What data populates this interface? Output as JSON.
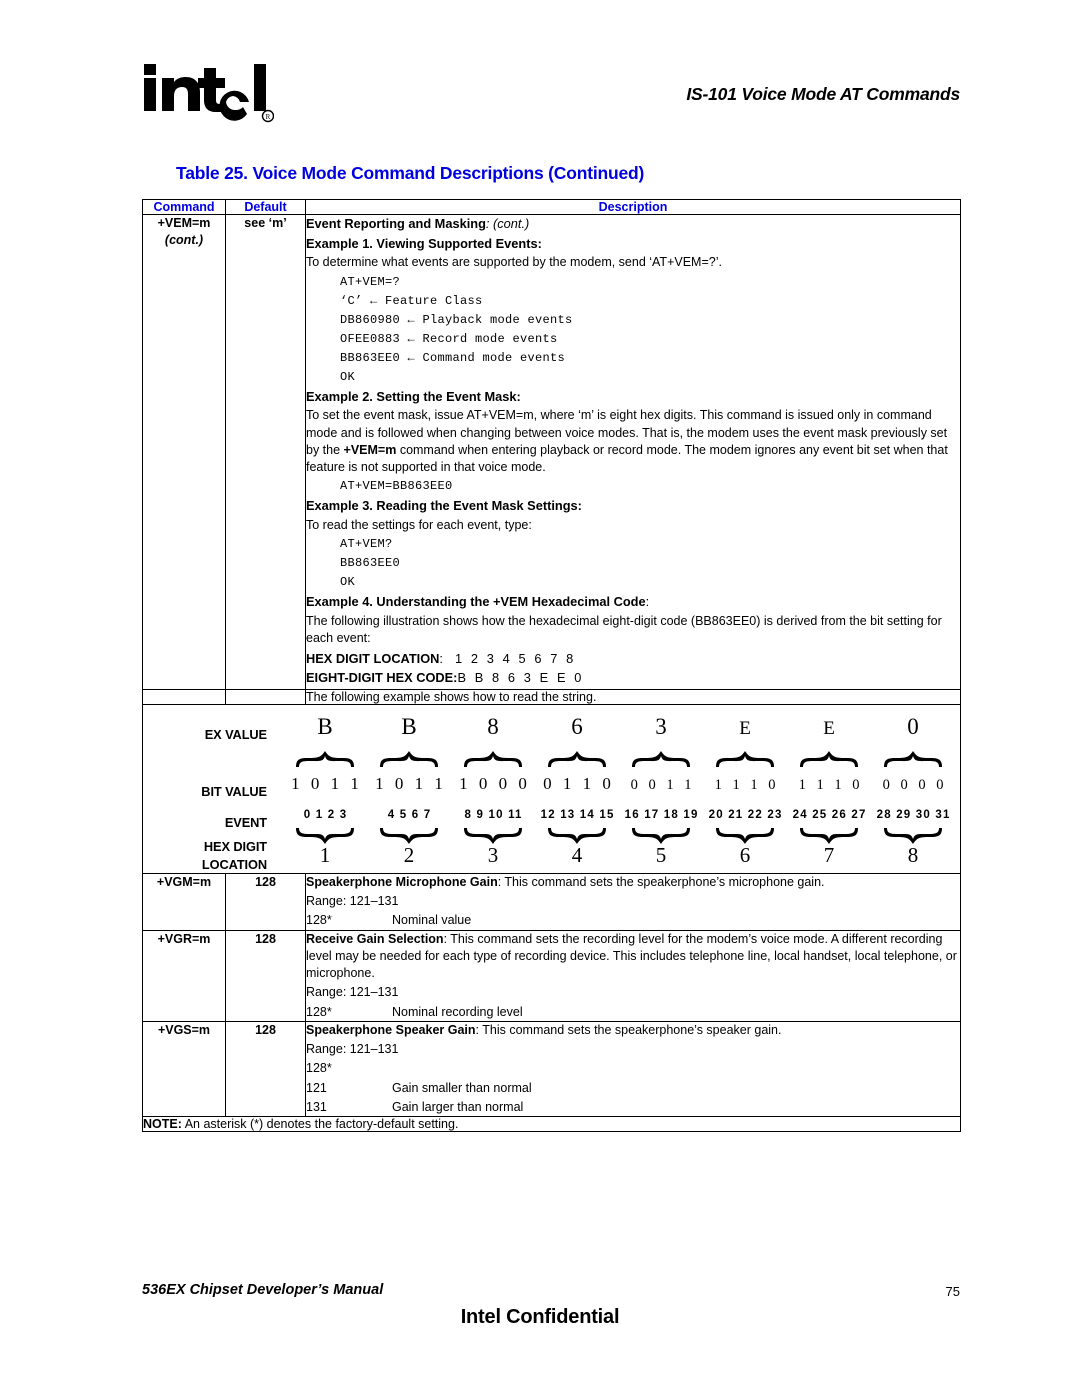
{
  "header": {
    "logo_alt": "intel",
    "title": "IS-101 Voice Mode AT Commands"
  },
  "table_caption": "Table 25.  Voice Mode Command Descriptions (Continued)",
  "table": {
    "columns": [
      "Command",
      "Default",
      "Description"
    ],
    "vem_row": {
      "command": "+VEM=m",
      "command_cont": "(cont.)",
      "default": "see ‘m’",
      "section_title": "Event Reporting and Masking",
      "section_title_suffix": ": (cont.)",
      "example1_heading": "Example 1. Viewing Supported Events:",
      "example1_intro": "To determine what events are supported by the modem, send ‘AT+VEM=?’.",
      "example1_code": [
        "AT+VEM=?",
        "‘C’ ← Feature Class",
        "DB860980 ← Playback mode events",
        "OFEE0883 ← Record mode events",
        "BB863EE0 ← Command mode events",
        "OK"
      ],
      "example2_heading": "Example 2. Setting the Event Mask:",
      "example2_body_1": "To set the event mask, issue AT+VEM=m, where ‘m’ is eight hex digits. This command is issued only in command mode and is followed when changing between voice modes. That is, the modem uses the event mask previously set by the ",
      "example2_body_bold": "+VEM=m",
      "example2_body_2": " command when entering playback or record mode. The modem ignores any event bit set when that feature is not supported in that voice mode.",
      "example2_code": [
        "AT+VEM=BB863EE0"
      ],
      "example3_heading": "Example 3. Reading the Event Mask Settings:",
      "example3_intro": "To read the settings for each event, type:",
      "example3_code": [
        "AT+VEM?",
        "BB863EE0",
        "OK"
      ],
      "example4_heading": "Example 4. Understanding the +VEM Hexadecimal Code",
      "example4_heading_suffix": ":",
      "example4_body": "The following illustration shows how the hexadecimal eight-digit code (BB863EE0) is derived from the bit setting for each event:",
      "hex_digit_location_label": "HEX DIGIT LOCATION",
      "hex_digit_location_colon": ":",
      "hex_digit_location_digits": "1 2 3 4 5 6 7 8",
      "eight_digit_hex_label": "EIGHT-DIGIT HEX CODE:",
      "eight_digit_hex_digits": "B B 8 6 3 E E 0"
    },
    "diagram_intro": "The following example shows how to read the string.",
    "diagram": {
      "labels": {
        "ex_value": "EX VALUE",
        "bit_value": "BIT VALUE",
        "event": "EVENT",
        "hex_digit_line1": "HEX DIGIT",
        "hex_digit_line2": "LOCATION"
      },
      "columns": [
        {
          "ex_value": "B",
          "bit_value": "1 0 1 1",
          "events": "0 1 2 3",
          "hex_location": "1"
        },
        {
          "ex_value": "B",
          "bit_value": "1 0 1 1",
          "events": "4 5 6 7",
          "hex_location": "2"
        },
        {
          "ex_value": "8",
          "bit_value": "1 0 0 0",
          "events": "8 9 10 11",
          "hex_location": "3"
        },
        {
          "ex_value": "6",
          "bit_value": "0 1 1 0",
          "events": "12 13 14 15",
          "hex_location": "4"
        },
        {
          "ex_value": "3",
          "bit_value": "0 0 1 1",
          "events": "16 17 18 19",
          "hex_location": "5"
        },
        {
          "ex_value": "E",
          "bit_value": "1 1 1 0",
          "events": "20 21 22 23",
          "hex_location": "6"
        },
        {
          "ex_value": "E",
          "bit_value": "1 1 1 0",
          "events": "24 25 26 27",
          "hex_location": "7"
        },
        {
          "ex_value": "0",
          "bit_value": "0 0 0 0",
          "events": "28 29 30 31",
          "hex_location": "8"
        }
      ]
    },
    "vgm_row": {
      "command": "+VGM=m",
      "default": "128",
      "title": "Speakerphone Microphone Gain",
      "description": ": This command sets the speakerphone’s microphone gain.",
      "range": "Range: 121–131",
      "values": [
        {
          "value": "128*",
          "meaning": "Nominal value"
        }
      ]
    },
    "vgr_row": {
      "command": "+VGR=m",
      "default": "128",
      "title": "Receive Gain Selection",
      "description": ": This command sets the recording level for the modem’s voice mode. A different recording level may be needed for each type of recording device. This includes telephone line, local handset, local telephone, or microphone.",
      "range": "Range: 121–131",
      "values": [
        {
          "value": "128*",
          "meaning": "Nominal recording level"
        }
      ]
    },
    "vgs_row": {
      "command": "+VGS=m",
      "default": "128",
      "title": "Speakerphone Speaker Gain",
      "description": ": This command sets the speakerphone’s speaker gain.",
      "range": "Range: 121–131",
      "values": [
        {
          "value": "128*",
          "meaning": ""
        },
        {
          "value": "121",
          "meaning": "Gain smaller than normal"
        },
        {
          "value": "131",
          "meaning": "Gain larger than normal"
        }
      ]
    },
    "note_label": "NOTE:",
    "note_text": "An asterisk (*) denotes the factory-default setting."
  },
  "footer": {
    "left": "536EX Chipset Developer’s Manual",
    "page_number": "75",
    "center": "Intel Confidential"
  },
  "colors": {
    "heading_blue": "#0000e0",
    "text_black": "#000000",
    "page_background": "#ffffff"
  }
}
